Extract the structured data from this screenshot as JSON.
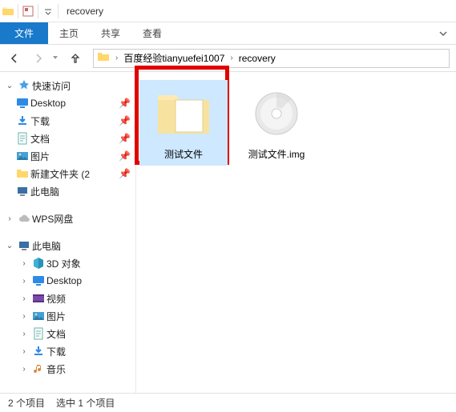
{
  "window": {
    "title": "recovery"
  },
  "ribbon": {
    "file_label": "文件",
    "tabs": [
      "主页",
      "共享",
      "查看"
    ]
  },
  "breadcrumb": {
    "segments": [
      "百度经验tianyuefei1007",
      "recovery"
    ]
  },
  "sidebar": {
    "quick_access": {
      "label": "快速访问"
    },
    "qa_items": [
      {
        "label": "Desktop",
        "icon": "desktop",
        "pinned": true
      },
      {
        "label": "下载",
        "icon": "download",
        "pinned": true
      },
      {
        "label": "文档",
        "icon": "doc",
        "pinned": true
      },
      {
        "label": "图片",
        "icon": "picture",
        "pinned": true
      },
      {
        "label": "新建文件夹 (2",
        "icon": "folder",
        "pinned": true
      },
      {
        "label": "此电脑",
        "icon": "pc",
        "pinned": false
      }
    ],
    "wps": {
      "label": "WPS网盘"
    },
    "this_pc": {
      "label": "此电脑"
    },
    "pc_items": [
      {
        "label": "3D 对象",
        "icon": "cube"
      },
      {
        "label": "Desktop",
        "icon": "desktop"
      },
      {
        "label": "视频",
        "icon": "video"
      },
      {
        "label": "图片",
        "icon": "picture"
      },
      {
        "label": "文档",
        "icon": "doc"
      },
      {
        "label": "下载",
        "icon": "download"
      },
      {
        "label": "音乐",
        "icon": "music"
      }
    ]
  },
  "content": {
    "items": [
      {
        "name": "测试文件",
        "type": "folder",
        "selected": true,
        "highlighted": true
      },
      {
        "name": "测试文件.img",
        "type": "disc",
        "selected": false,
        "highlighted": false
      }
    ]
  },
  "status": {
    "count_label": "2 个项目",
    "selection_label": "选中 1 个项目"
  }
}
